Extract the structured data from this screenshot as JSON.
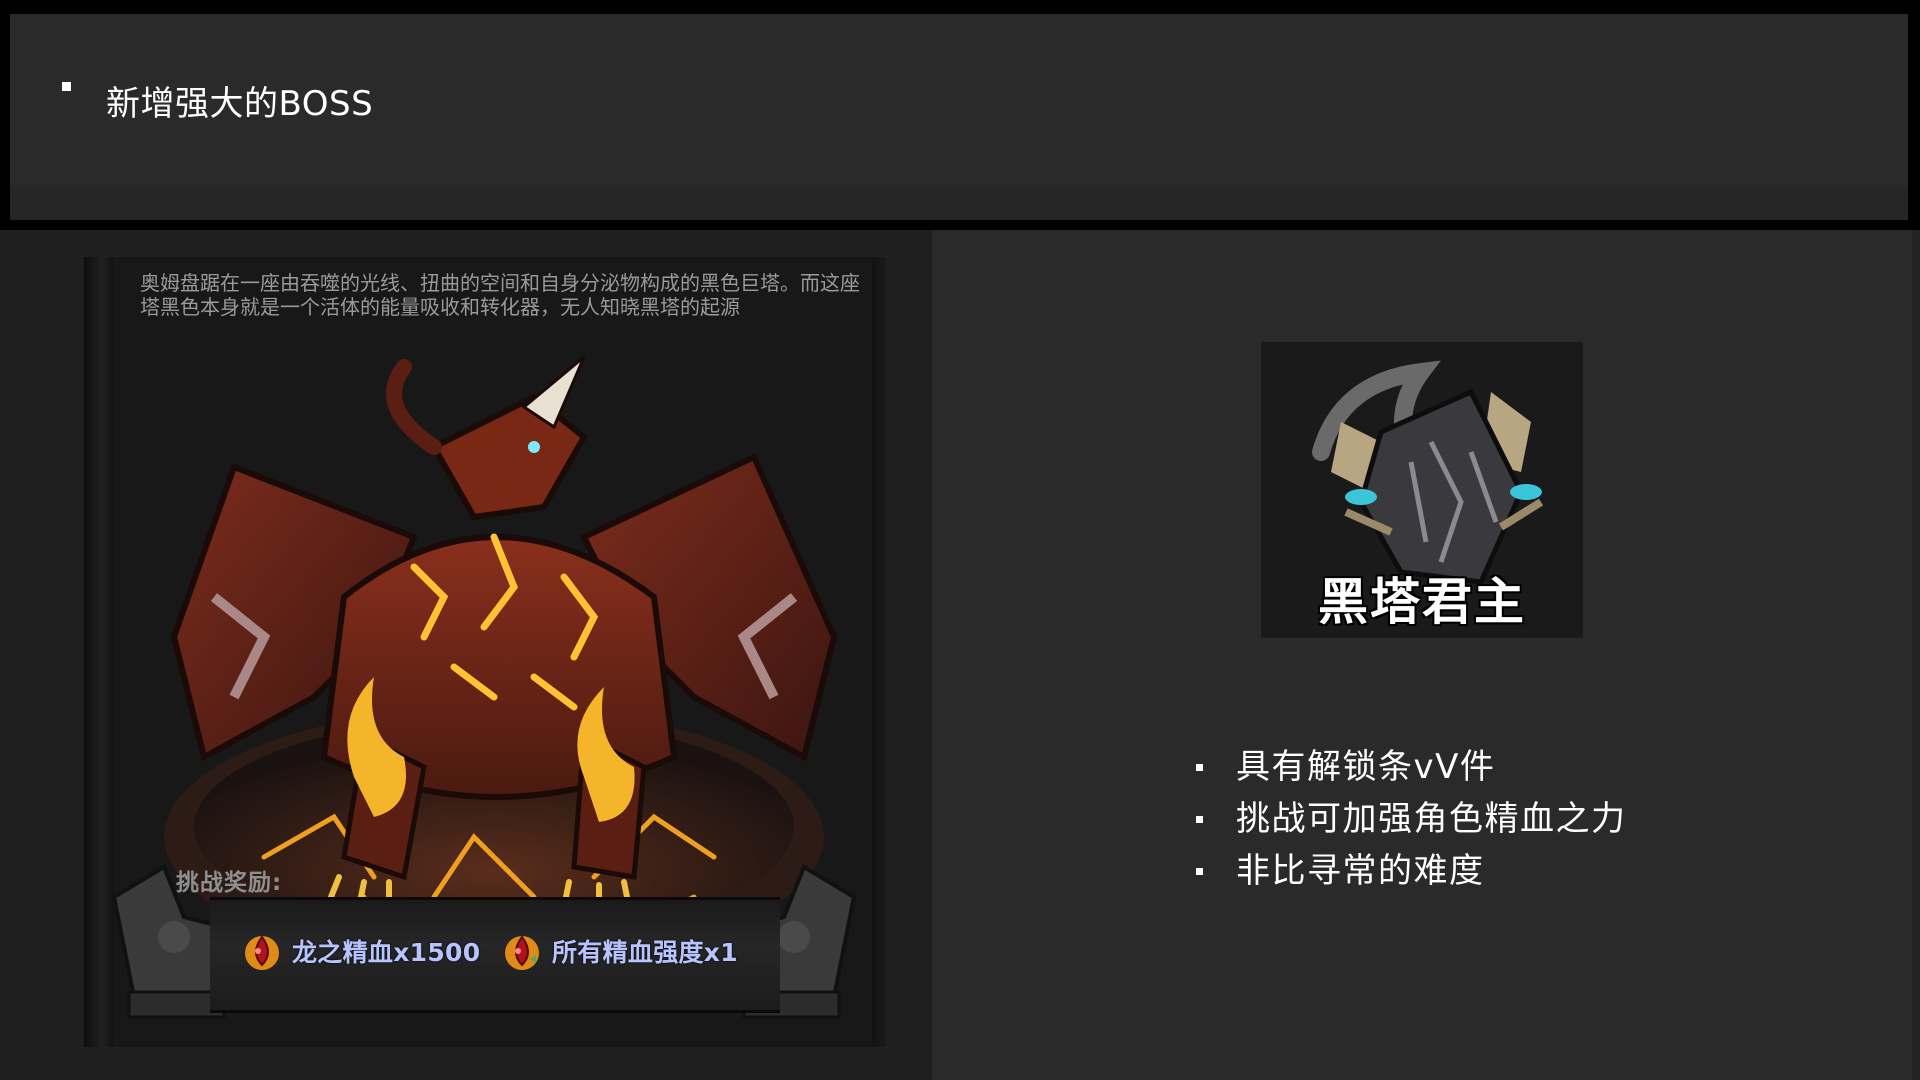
{
  "header": {
    "title": "新增强大的BOSS"
  },
  "boss_card": {
    "description": "奥姆盘踞在一座由吞噬的光线、扭曲的空间和自身分泌物构成的黑色巨塔。而这座塔黑色本身就是一个活体的能量吸收和转化器，无人知晓黑塔的起源",
    "reward_label": "挑战奖励:",
    "rewards": [
      {
        "icon": "blood-drop-icon",
        "label": "龙之精血x1500"
      },
      {
        "icon": "blood-drop-icon",
        "label": "所有精血强度x1"
      }
    ]
  },
  "boss_portrait": {
    "name": "黑塔君主"
  },
  "features": [
    "具有解锁条vV件",
    "挑战可加强角色精血之力",
    "非比寻常的难度"
  ],
  "colors": {
    "background": "#232323",
    "header_panel": "#2a2a2a",
    "reward_text": "#b7c4ff",
    "description_text": "#9a9a9a"
  }
}
